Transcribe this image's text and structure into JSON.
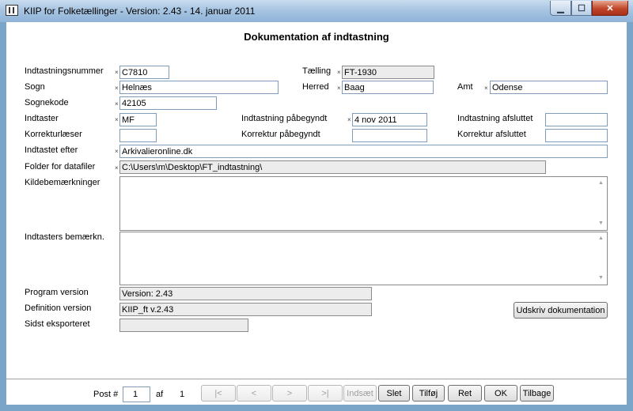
{
  "window": {
    "title": "KIIP for Folketællinger - Version: 2.43 - 14. januar 2011",
    "min_glyph": "▁",
    "max_glyph": "☐",
    "close_glyph": "✕"
  },
  "form": {
    "heading": "Dokumentation af indtastning",
    "required_mark": "×",
    "fields": {
      "indtastningsnummer": {
        "label": "Indtastningsnummer",
        "value": "C7810"
      },
      "taelling": {
        "label": "Tælling",
        "value": "FT-1930"
      },
      "sogn": {
        "label": "Sogn",
        "value": "Helnæs"
      },
      "herred": {
        "label": "Herred",
        "value": "Baag"
      },
      "amt": {
        "label": "Amt",
        "value": "Odense"
      },
      "sognekode": {
        "label": "Sognekode",
        "value": "42105"
      },
      "indtaster": {
        "label": "Indtaster",
        "value": "MF"
      },
      "indtastning_paabegyndt": {
        "label": "Indtastning påbegyndt",
        "value": "4 nov 2011"
      },
      "indtastning_afsluttet": {
        "label": "Indtastning afsluttet",
        "value": ""
      },
      "korrekturlaeser": {
        "label": "Korrekturlæser",
        "value": ""
      },
      "korrektur_paabegyndt": {
        "label": "Korrektur påbegyndt",
        "value": ""
      },
      "korrektur_afsluttet": {
        "label": "Korrektur afsluttet",
        "value": ""
      },
      "indtastet_efter": {
        "label": "Indtastet efter",
        "value": "Arkivalieronline.dk"
      },
      "folder": {
        "label": "Folder for datafiler",
        "value": "C:\\Users\\m\\Desktop\\FT_indtastning\\"
      },
      "kildebemaerkninger": {
        "label": "Kildebemærkninger",
        "value": ""
      },
      "indtasters_bemaerkn": {
        "label": "Indtasters bemærkn.",
        "value": ""
      },
      "program_version": {
        "label": "Program version",
        "value": "Version: 2.43"
      },
      "definition_version": {
        "label": "Definition version",
        "value": "KIIP_ft v.2.43"
      },
      "sidst_eksporteret": {
        "label": "Sidst eksporteret",
        "value": ""
      }
    },
    "print_button": "Udskriv dokumentation"
  },
  "navigation": {
    "post_label": "Post #",
    "post_value": "1",
    "of_label": "af",
    "total": "1",
    "first": "|<",
    "prev": "<",
    "next": ">",
    "last": ">|",
    "insert": "Indsæt",
    "delete": "Slet",
    "add": "Tilføj",
    "edit": "Ret",
    "ok": "OK",
    "back": "Tilbage"
  },
  "scroll_glyphs": {
    "up": "▲",
    "down": "▼"
  }
}
